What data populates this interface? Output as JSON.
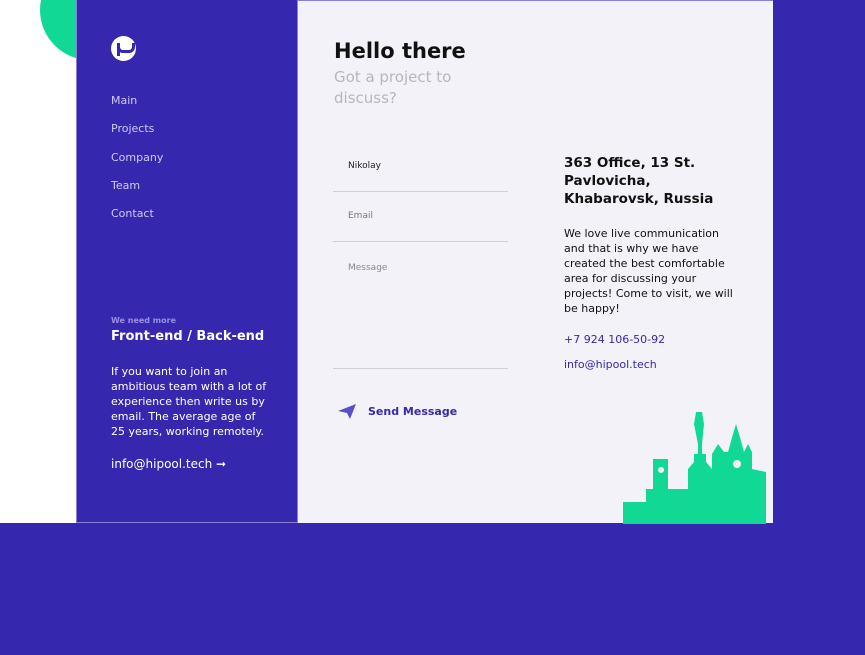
{
  "sidebar": {
    "logo": "hipool",
    "nav": [
      "Main",
      "Projects",
      "Company",
      "Team",
      "Contact"
    ],
    "kicker": "We need more",
    "role": "Front-end / Back-end",
    "description": "If you want to join an ambitious team with a lot of experience then write us by email. The average age of 25 years, working remotely.",
    "email": "info@hipool.tech",
    "arrow": "➞"
  },
  "main": {
    "title": "Hello there",
    "subtitle": "Got a project to discuss?",
    "form": {
      "name_value": "Nikolay",
      "email_placeholder": "Email",
      "message_placeholder": "Message",
      "send_label": "Send Message"
    },
    "address": "363 Office, 13 St. Pavlovicha, Khabarovsk, Russia",
    "about": "We love live communication and that is why we have created the best comfortable area for discussing your projects! Come to visit, we will be happy!",
    "phone": "+7 924 106-50-92",
    "email": "info@hipool.tech"
  },
  "colors": {
    "brand": "#3628ae",
    "accent": "#12d896",
    "panel": "#f3f2f8"
  }
}
